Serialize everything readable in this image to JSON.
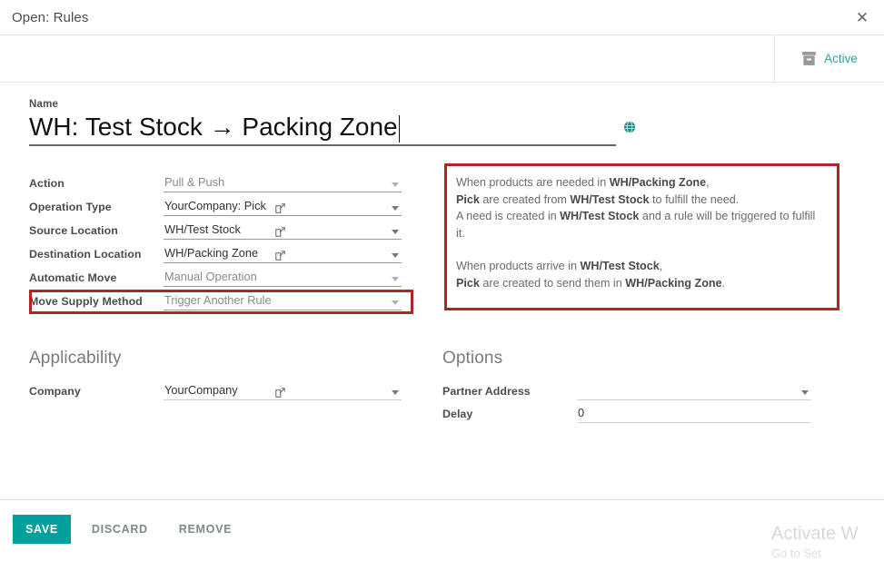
{
  "dialog": {
    "title": "Open: Rules",
    "close_icon": "close-icon"
  },
  "statusbar": {
    "archive_icon": "archive-box-icon",
    "active_label": "Active"
  },
  "name_field": {
    "label": "Name",
    "value": "WH: Test Stock → Packing Zone",
    "translate_icon": "globe-icon"
  },
  "main_fields": [
    {
      "label": "Action",
      "value": "Pull & Push",
      "muted": true,
      "ext_link": false
    },
    {
      "label": "Operation Type",
      "value": "YourCompany: Pick",
      "muted": false,
      "ext_link": true
    },
    {
      "label": "Source Location",
      "value": "WH/Test Stock",
      "muted": false,
      "ext_link": true
    },
    {
      "label": "Destination Location",
      "value": "WH/Packing Zone",
      "muted": false,
      "ext_link": true
    },
    {
      "label": "Automatic Move",
      "value": "Manual Operation",
      "muted": true,
      "ext_link": false
    },
    {
      "label": "Move Supply Method",
      "value": "Trigger Another Rule",
      "muted": true,
      "ext_link": false
    }
  ],
  "info_panel": {
    "block1": [
      [
        {
          "t": "When products are needed in ",
          "b": false
        },
        {
          "t": "WH/Packing Zone",
          "b": true
        },
        {
          "t": ",",
          "b": false
        }
      ],
      [
        {
          "t": "Pick",
          "b": true
        },
        {
          "t": " are created from ",
          "b": false
        },
        {
          "t": "WH/Test Stock",
          "b": true
        },
        {
          "t": " to fulfill the need.",
          "b": false
        }
      ],
      [
        {
          "t": "A need is created in ",
          "b": false
        },
        {
          "t": "WH/Test Stock",
          "b": true
        },
        {
          "t": " and a rule will be triggered to fulfill it.",
          "b": false
        }
      ]
    ],
    "block2": [
      [
        {
          "t": "When products arrive in ",
          "b": false
        },
        {
          "t": "WH/Test Stock",
          "b": true
        },
        {
          "t": ",",
          "b": false
        }
      ],
      [
        {
          "t": "Pick",
          "b": true
        },
        {
          "t": " are created to send them in ",
          "b": false
        },
        {
          "t": "WH/Packing Zone",
          "b": true
        },
        {
          "t": ".",
          "b": false
        }
      ]
    ]
  },
  "applicability": {
    "title": "Applicability",
    "company_label": "Company",
    "company_value": "YourCompany"
  },
  "options": {
    "title": "Options",
    "partner_label": "Partner Address",
    "partner_value": "",
    "delay_label": "Delay",
    "delay_value": "0"
  },
  "footer": {
    "save_label": "SAVE",
    "discard_label": "DISCARD",
    "remove_label": "REMOVE"
  },
  "watermark": {
    "line1": "Activate W",
    "line2": "Go to Set"
  },
  "colors": {
    "accent_teal": "#00a09d",
    "highlight_red": "#b02525",
    "label_gray": "#4c4c4c"
  }
}
